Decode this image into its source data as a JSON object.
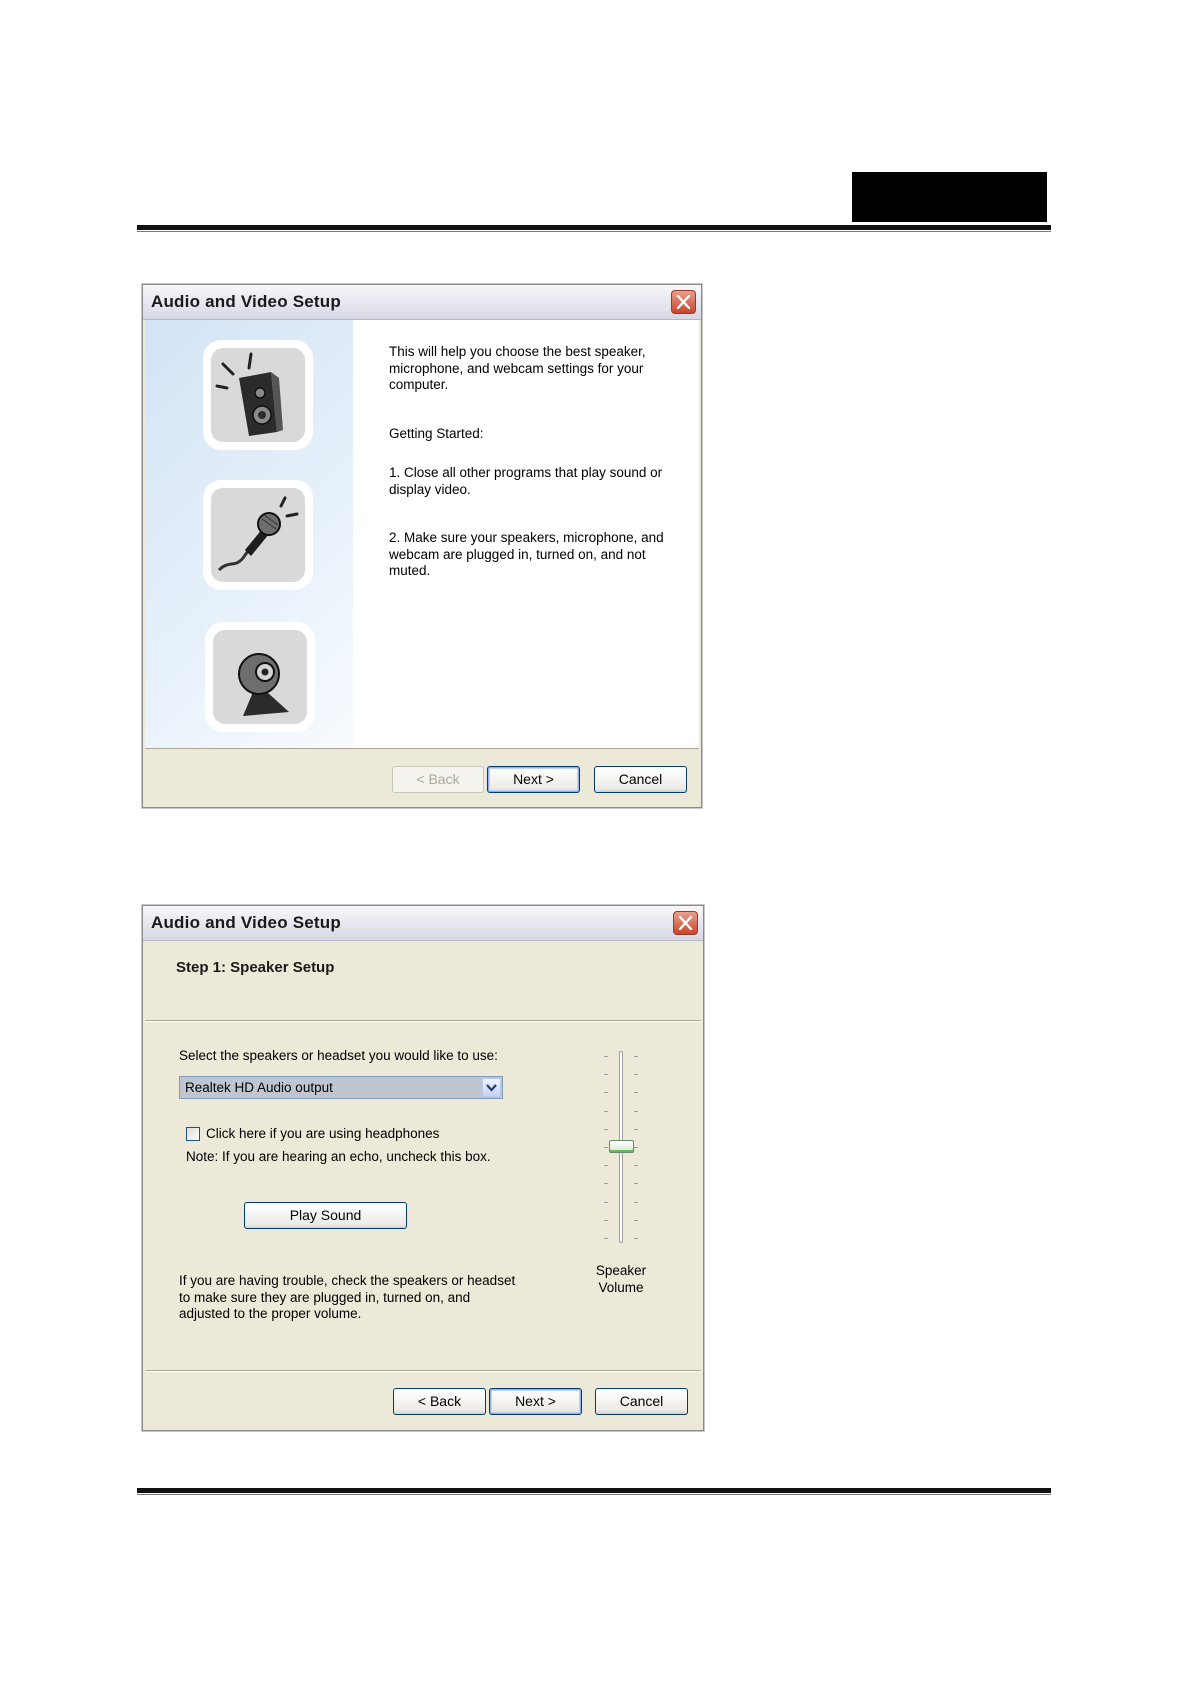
{
  "dialog1": {
    "title": "Audio and Video Setup",
    "intro": "This will help you choose the best speaker,\nmicrophone, and webcam settings for your\ncomputer.",
    "getting_started": "Getting Started:",
    "step1": "1. Close all other programs that play sound or\ndisplay video.",
    "step2": "2. Make sure your speakers, microphone, and\nwebcam are plugged in, turned on, and not\nmuted.",
    "back_label": "< Back",
    "next_label": "Next >",
    "cancel_label": "Cancel",
    "icons": [
      "speaker-icon",
      "microphone-icon",
      "webcam-icon"
    ]
  },
  "dialog2": {
    "title": "Audio and Video Setup",
    "step_title": "Step 1: Speaker Setup",
    "select_label": "Select the speakers or headset you would like to use:",
    "select_value": "Realtek HD Audio output",
    "headphones_label": "Click here if you are using headphones",
    "note": "Note: If you are hearing an echo, uncheck this box.",
    "play_sound_label": "Play Sound",
    "trouble_text": "If you are having trouble, check the speakers or headset\nto make sure they are plugged in, turned on, and\nadjusted to the proper volume.",
    "volume_label": "Speaker\nVolume",
    "volume_level": 0.5,
    "headphones_checked": false,
    "back_label": "< Back",
    "next_label": "Next >",
    "cancel_label": "Cancel"
  },
  "colors": {
    "dialog_bg": "#ece9d8",
    "button_border": "#003c74",
    "close_red": "#c9452d",
    "sidepanel_blue": "#d3e3f5"
  }
}
